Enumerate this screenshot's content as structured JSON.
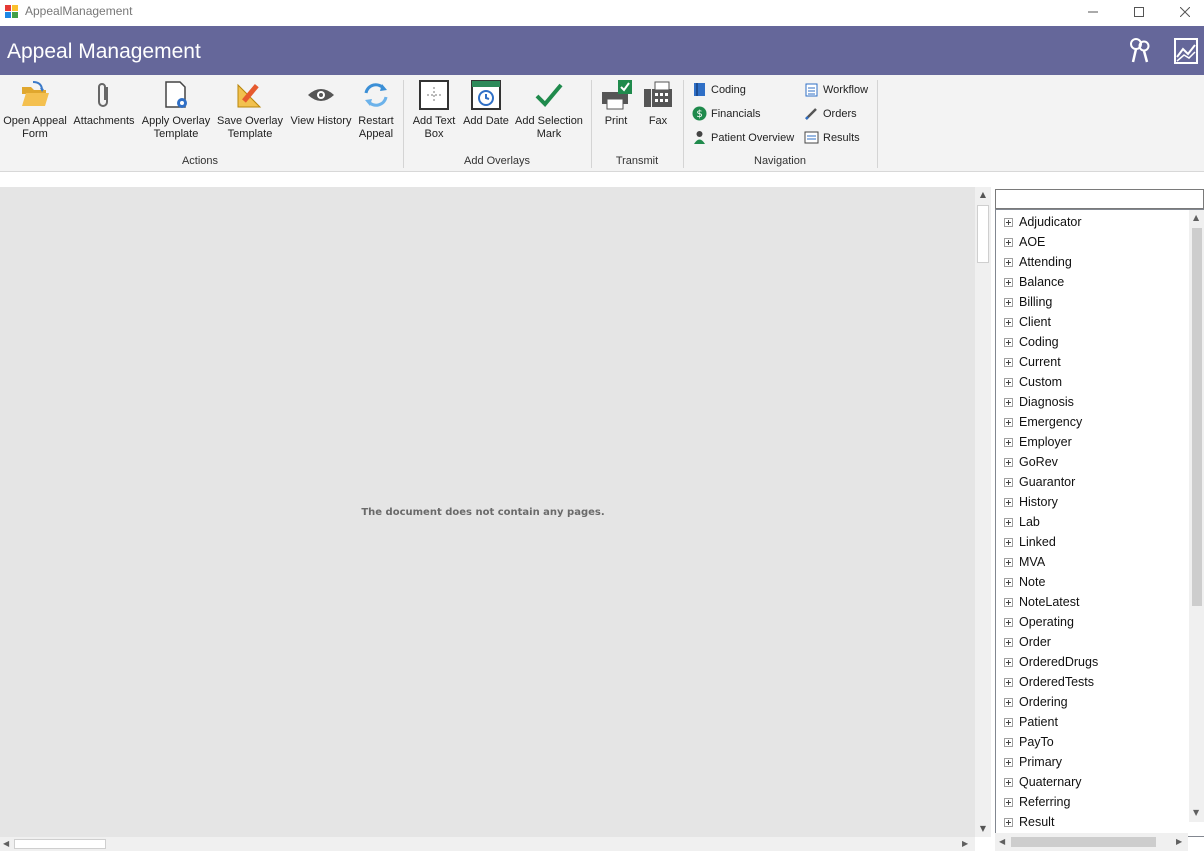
{
  "window": {
    "title": "AppealManagement"
  },
  "header": {
    "title": "Appeal Management",
    "icons": [
      "keys-icon",
      "chart-icon"
    ]
  },
  "ribbon": {
    "groups": [
      {
        "label": "Actions",
        "buttons": [
          {
            "line1": "Open Appeal",
            "line2": "Form",
            "icon": "folder-open-icon"
          },
          {
            "line1": "Attachments",
            "line2": "",
            "icon": "paperclip-icon"
          },
          {
            "line1": "Apply Overlay",
            "line2": "Template",
            "icon": "document-gear-icon"
          },
          {
            "line1": "Save Overlay",
            "line2": "Template",
            "icon": "ruler-pencil-icon"
          },
          {
            "line1": "View History",
            "line2": "",
            "icon": "eye-icon"
          },
          {
            "line1": "Restart",
            "line2": "Appeal",
            "icon": "refresh-icon"
          }
        ]
      },
      {
        "label": "Add Overlays",
        "buttons": [
          {
            "line1": "Add Text",
            "line2": "Box",
            "icon": "text-box-icon"
          },
          {
            "line1": "Add Date",
            "line2": "",
            "icon": "calendar-icon"
          },
          {
            "line1": "Add Selection",
            "line2": "Mark",
            "icon": "checkmark-icon"
          }
        ]
      },
      {
        "label": "Transmit",
        "buttons": [
          {
            "line1": "Print",
            "line2": "",
            "icon": "printer-icon"
          },
          {
            "line1": "Fax",
            "line2": "",
            "icon": "fax-icon"
          }
        ]
      },
      {
        "label": "Navigation",
        "buttons": [
          {
            "label": "Coding",
            "icon": "book-icon"
          },
          {
            "label": "Financials",
            "icon": "dollar-icon"
          },
          {
            "label": "Patient Overview",
            "icon": "person-icon"
          },
          {
            "label": "Workflow",
            "icon": "clipboard-icon"
          },
          {
            "label": "Orders",
            "icon": "pen-icon"
          },
          {
            "label": "Results",
            "icon": "results-icon"
          }
        ]
      }
    ]
  },
  "viewer": {
    "empty_message": "The document does not contain any pages."
  },
  "field_tree": {
    "search_value": "",
    "items": [
      "Adjudicator",
      "AOE",
      "Attending",
      "Balance",
      "Billing",
      "Client",
      "Coding",
      "Current",
      "Custom",
      "Diagnosis",
      "Emergency",
      "Employer",
      "GoRev",
      "Guarantor",
      "History",
      "Lab",
      "Linked",
      "MVA",
      "Note",
      "NoteLatest",
      "Operating",
      "Order",
      "OrderedDrugs",
      "OrderedTests",
      "Ordering",
      "Patient",
      "PayTo",
      "Primary",
      "Quaternary",
      "Referring",
      "Result"
    ]
  },
  "colors": {
    "header": "#65679a",
    "ribbon": "#f3f3f3",
    "viewer": "#e5e5e5",
    "accent_green": "#1f8a4c"
  }
}
